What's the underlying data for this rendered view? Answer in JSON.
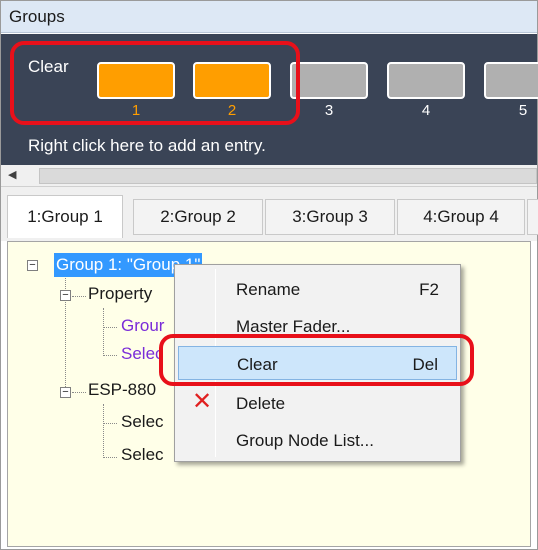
{
  "window": {
    "title": "Groups"
  },
  "strip": {
    "clear_label": "Clear",
    "groups": [
      {
        "label": "1",
        "active": true
      },
      {
        "label": "2",
        "active": true
      },
      {
        "label": "3",
        "active": false
      },
      {
        "label": "4",
        "active": false
      },
      {
        "label": "5",
        "active": false
      }
    ],
    "hint": "Right click here to add an entry."
  },
  "scrollbar": {
    "left_arrow": "◀"
  },
  "tabs": [
    {
      "label": "1:Group 1",
      "active": true
    },
    {
      "label": "2:Group 2",
      "active": false
    },
    {
      "label": "3:Group 3",
      "active": false
    },
    {
      "label": "4:Group 4",
      "active": false
    }
  ],
  "tree": {
    "root": "Group 1: \"Group 1\"",
    "property": "Property",
    "property_children": [
      "Grour",
      "Selec"
    ],
    "device": "ESP-880",
    "device_children": [
      "Selec",
      "Selec"
    ]
  },
  "context_menu": {
    "items": [
      {
        "label": "Rename",
        "shortcut": "F2",
        "icon": ""
      },
      {
        "label": "Master Fader...",
        "shortcut": "",
        "icon": ""
      },
      {
        "label": "Clear",
        "shortcut": "Del",
        "icon": ""
      },
      {
        "label": "Delete",
        "shortcut": "",
        "icon": "delete-x-icon"
      },
      {
        "label": "Group Node List...",
        "shortcut": "",
        "icon": ""
      }
    ]
  },
  "colors": {
    "strip_bg": "#3a4456",
    "active_group": "#ff9e00",
    "inactive_group": "#b0b0b0",
    "tree_bg": "#ffffe8",
    "highlight": "#e8101a",
    "selection": "#3399ff"
  }
}
